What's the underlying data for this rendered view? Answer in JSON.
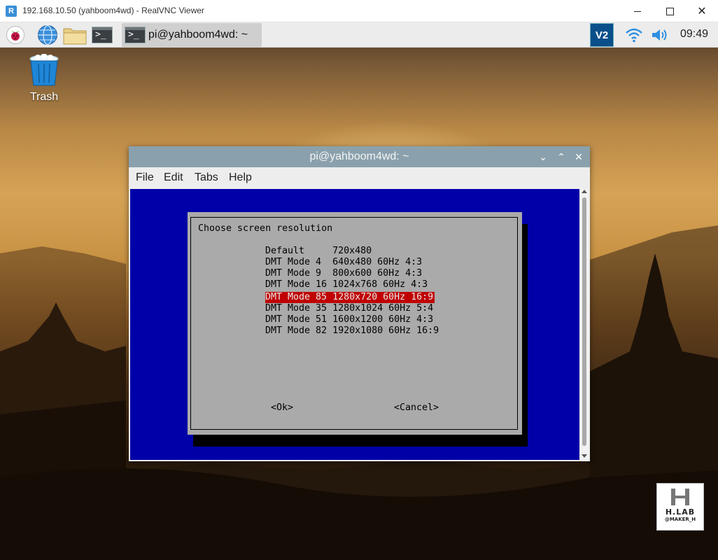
{
  "viewer": {
    "title": "192.168.10.50 (yahboom4wd) - RealVNC Viewer",
    "app_icon_letter": "R"
  },
  "panel": {
    "launchers": [
      "raspberry-menu-icon",
      "web-browser-icon",
      "file-manager-icon",
      "terminal-icon"
    ],
    "task": {
      "label": "pi@yahboom4wd: ~"
    },
    "tray": {
      "vnc": "V2",
      "clock": "09:49"
    }
  },
  "desktop": {
    "icons": [
      {
        "label": "Trash"
      }
    ]
  },
  "terminal": {
    "title": "pi@yahboom4wd: ~",
    "menu": [
      "File",
      "Edit",
      "Tabs",
      "Help"
    ]
  },
  "dialog": {
    "title": "Choose screen resolution",
    "options": [
      {
        "label": "Default     720x480",
        "selected": false
      },
      {
        "label": "DMT Mode 4  640x480 60Hz 4:3",
        "selected": false
      },
      {
        "label": "DMT Mode 9  800x600 60Hz 4:3",
        "selected": false
      },
      {
        "label": "DMT Mode 16 1024x768 60Hz 4:3",
        "selected": false
      },
      {
        "label": "DMT Mode 85 1280x720 60Hz 16:9",
        "selected": true
      },
      {
        "label": "DMT Mode 35 1280x1024 60Hz 5:4",
        "selected": false
      },
      {
        "label": "DMT Mode 51 1600x1200 60Hz 4:3",
        "selected": false
      },
      {
        "label": "DMT Mode 82 1920x1080 60Hz 16:9",
        "selected": false
      }
    ],
    "ok_label": "<Ok>",
    "cancel_label": "<Cancel>"
  },
  "watermark": {
    "title": "H.LAB",
    "subtitle": "@MAKER_H"
  },
  "colors": {
    "dialog_bg": "#aaaaaa",
    "terminal_bg": "#0000a8",
    "selection": "#c00000",
    "titlebar": "#8aa1ad"
  }
}
